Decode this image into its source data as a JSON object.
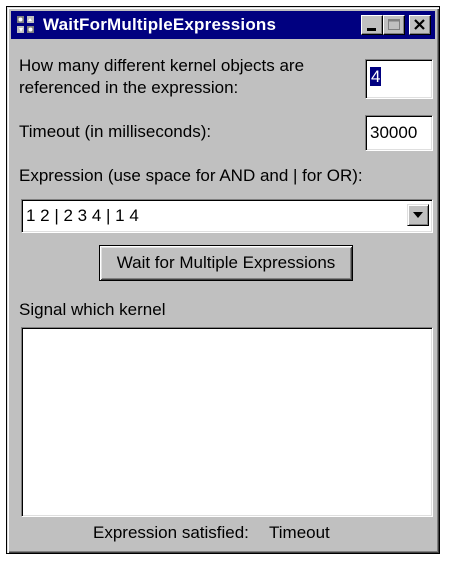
{
  "window": {
    "title": "WaitForMultipleExpressions",
    "controls": {
      "minimize": "minimize",
      "maximize": "maximize",
      "close": "close"
    }
  },
  "kernel_count": {
    "label_line1": "How many different kernel objects are",
    "label_line2": "referenced in the expression:",
    "value": "4"
  },
  "timeout": {
    "label": "Timeout (in milliseconds):",
    "value": "30000"
  },
  "expression": {
    "label": "Expression (use space for AND and | for OR):",
    "value": "1 2 | 2 3 4 | 1 4"
  },
  "wait_button": {
    "label": "Wait for Multiple Expressions"
  },
  "signal": {
    "label": "Signal which kernel"
  },
  "status": {
    "label": "Expression satisfied:",
    "value": "Timeout"
  },
  "icons": {
    "app": "app-icon",
    "minimize": "minimize-icon",
    "maximize": "maximize-icon",
    "close": "close-icon",
    "dropdown": "chevron-down-icon"
  }
}
